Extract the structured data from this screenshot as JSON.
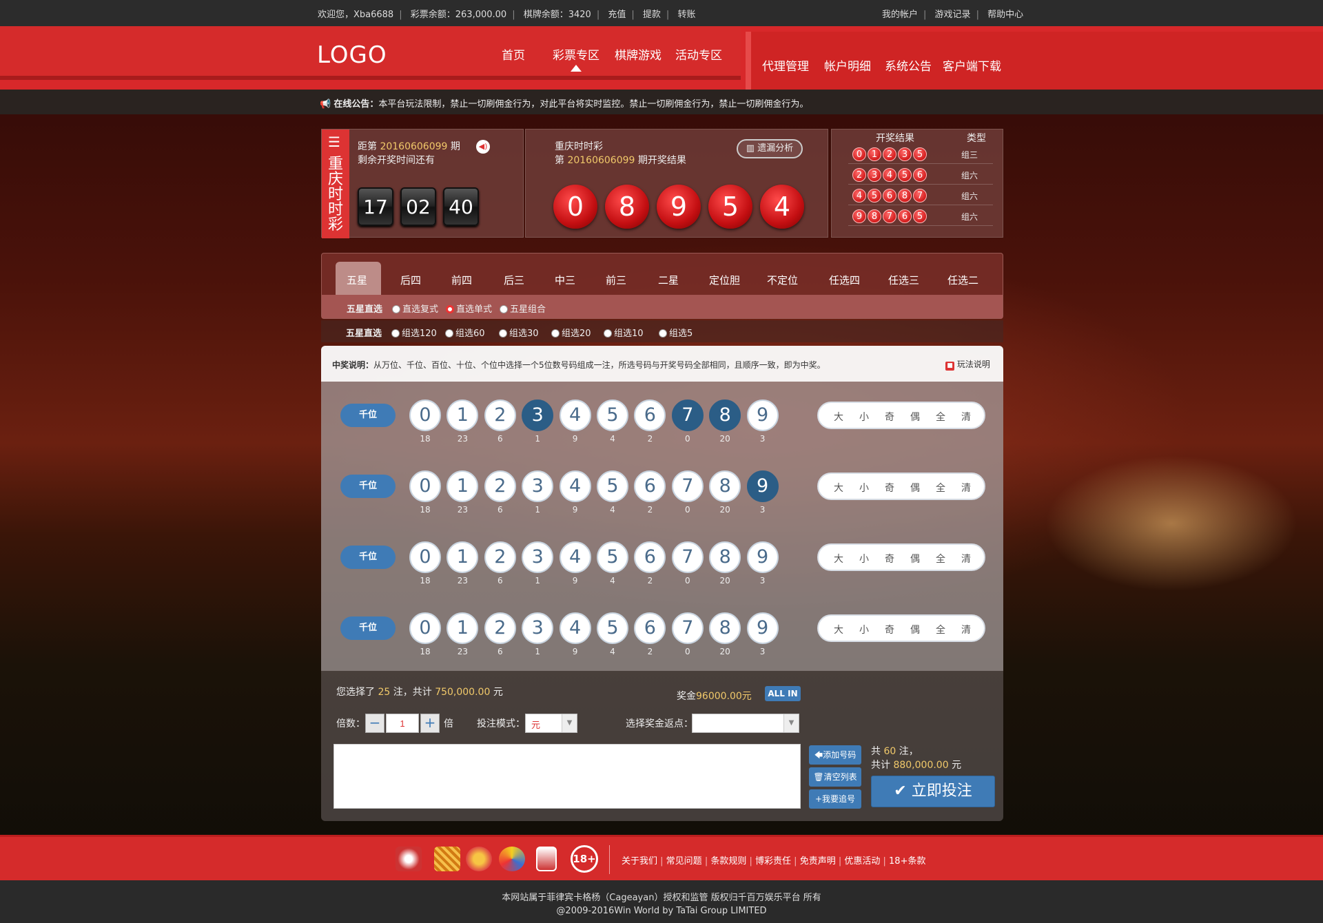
{
  "topbar": {
    "welcome": "欢迎您，Xba6688",
    "lottery_balance": "彩票余额：263,000.00",
    "chess_balance": "棋牌余额：3420",
    "recharge": "充值",
    "withdraw": "提款",
    "transfer": "转账",
    "my_account": "我的帐户",
    "game_records": "游戏记录",
    "help": "帮助中心"
  },
  "header": {
    "logo": "LOGO",
    "nav": [
      "首页",
      "彩票专区",
      "棋牌游戏",
      "活动专区"
    ],
    "nav_right": [
      "代理管理",
      "帐户明细",
      "系统公告",
      "客户端下载"
    ]
  },
  "notice": {
    "label": "在线公告：",
    "text": "本平台玩法限制，禁止一切刷佣金行为，对此平台将实时监控。禁止一切刷佣金行为，禁止一切刷佣金行为。"
  },
  "countdown": {
    "game_name": "重庆时时彩",
    "prefix": "距第",
    "issue": "20160606099",
    "suffix": "期",
    "remaining": "剩余开奖时间还有",
    "hh": "17",
    "mm": "02",
    "ss": "40"
  },
  "result": {
    "game_name": "重庆时时彩",
    "prefix": "第",
    "issue": "20160606099",
    "suffix": "期开奖结果",
    "analysis_button": "遗漏分析",
    "balls": [
      "0",
      "8",
      "9",
      "5",
      "4"
    ]
  },
  "history": {
    "col_result": "开奖结果",
    "col_type": "类型",
    "rows": [
      {
        "balls": [
          "0",
          "1",
          "2",
          "3",
          "5"
        ],
        "type": "组三"
      },
      {
        "balls": [
          "2",
          "3",
          "4",
          "5",
          "6"
        ],
        "type": "组六"
      },
      {
        "balls": [
          "4",
          "5",
          "6",
          "8",
          "7"
        ],
        "type": "组六"
      },
      {
        "balls": [
          "9",
          "8",
          "7",
          "6",
          "5"
        ],
        "type": "组六"
      }
    ]
  },
  "tabs": [
    "五星",
    "后四",
    "前四",
    "后三",
    "中三",
    "前三",
    "二星",
    "定位胆",
    "不定位",
    "任选四",
    "任选三",
    "任选二"
  ],
  "subtypes": {
    "row1_label": "五星直选",
    "row1": [
      "直选复式",
      "直选单式",
      "五星组合"
    ],
    "row2_label": "五星直选",
    "row2": [
      "组选120",
      "组选60",
      "组选30",
      "组选20",
      "组选10",
      "组选5"
    ]
  },
  "desc": {
    "label": "中奖说明：",
    "text": "从万位、千位、百位、十位、个位中选择一个5位数号码组成一注，所选号码与开奖号码全部相同，且顺序一致，即为中奖。",
    "rules_link": "玩法说明"
  },
  "bet_rows": [
    {
      "position": "千位",
      "selected": [
        "3",
        "7",
        "8"
      ]
    },
    {
      "position": "千位",
      "selected": [
        "9"
      ]
    },
    {
      "position": "千位",
      "selected": []
    },
    {
      "position": "千位",
      "selected": []
    }
  ],
  "numbers": [
    "0",
    "1",
    "2",
    "3",
    "4",
    "5",
    "6",
    "7",
    "8",
    "9"
  ],
  "missing": [
    "18",
    "23",
    "6",
    "1",
    "9",
    "4",
    "2",
    "0",
    "20",
    "3"
  ],
  "quick_select": [
    "大",
    "小",
    "奇",
    "偶",
    "全",
    "清"
  ],
  "summary": {
    "selected_prefix": "您选择了",
    "selected_count": "25",
    "selected_mid": "注，共计",
    "selected_amount": "750,000.00",
    "selected_unit": "元",
    "prize_label": "奖金",
    "prize_value": "96000.00元",
    "all_in": "ALL IN",
    "multiplier_label": "倍数：",
    "multiplier_value": "1",
    "multiplier_unit": "倍",
    "mode_label": "投注模式：",
    "mode_value": "元",
    "rebate_label": "选择奖金返点：",
    "rebate_value": ""
  },
  "actions": {
    "add": "添加号码",
    "clear": "清空列表",
    "chase": "我要追号",
    "total_prefix": "共",
    "total_count": "60",
    "total_unit": "注，",
    "total_label": "共计",
    "total_amount": "880,000.00",
    "total_currency": "元",
    "submit": "立即投注"
  },
  "footer": {
    "links": [
      "关于我们",
      "常见问题",
      "条款规则",
      "博彩责任",
      "免责声明",
      "优惠活动",
      "18+条款"
    ],
    "logos": [
      "isle-of-man-logo",
      "pagcor-logo",
      "ncgaf-logo",
      "first-cagayan-logo",
      "gic-logo",
      "age-18-logo"
    ],
    "age_badge": "18+",
    "copy1": "本网站属于菲律宾卡格杨（Cageayan）授权和监管 版权归千百万娱乐平台 所有",
    "copy2": "@2009-2016Win World by TaTai Group LIMITED"
  },
  "colors": {
    "brand_red": "#d52b2b",
    "ball_red": "#c40f12",
    "selected_blue": "#2b5d86",
    "gold": "#f1c96a"
  }
}
